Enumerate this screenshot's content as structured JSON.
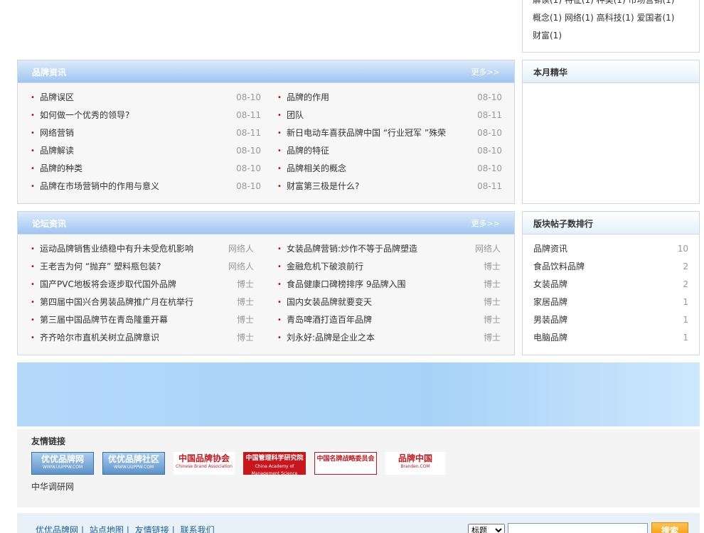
{
  "tags": {
    "line1": "解读(1) 特征(1) 种类(1) 市场营销(1)",
    "line2": "概念(1)  网络(1)  高科技(1)  爱国者(1)",
    "line3": "财富(1)"
  },
  "brand_news": {
    "title": "品牌资讯",
    "more": "更多>>",
    "left": [
      {
        "title": "品牌误区",
        "date": "08-10"
      },
      {
        "title": "如何做一个优秀的领导?",
        "date": "08-11"
      },
      {
        "title": "网络营销",
        "date": "08-11"
      },
      {
        "title": "品牌解读",
        "date": "08-10"
      },
      {
        "title": "品牌的种类",
        "date": "08-10"
      },
      {
        "title": "品牌在市场营销中的作用与意义",
        "date": "08-10"
      }
    ],
    "right": [
      {
        "title": "品牌的作用",
        "date": "08-10"
      },
      {
        "title": "团队",
        "date": "08-11"
      },
      {
        "title": "新日电动车喜获品牌中国 “行业冠军 ”殊荣",
        "date": "08-10"
      },
      {
        "title": "品牌的特征",
        "date": "08-10"
      },
      {
        "title": "品牌相关的概念",
        "date": "08-10"
      },
      {
        "title": "财富第三极是什么?",
        "date": "08-11"
      }
    ]
  },
  "monthly": {
    "title": "本月精华"
  },
  "forum_news": {
    "title": "论坛资讯",
    "more": "更多>>",
    "left": [
      {
        "title": "运动品牌销售业绩稳中有升未受危机影响",
        "author": "网络人"
      },
      {
        "title": "王老吉为何 “抛弃” 塑料瓶包装?",
        "author": "网络人"
      },
      {
        "title": "国产PVC地板将会逐步取代国外品牌",
        "author": "博士"
      },
      {
        "title": "第四届中国兴合男装品牌推广月在杭举行",
        "author": "博士"
      },
      {
        "title": "第三届中国品牌节在青岛隆重开幕",
        "author": "博士"
      },
      {
        "title": "齐齐哈尔市直机关树立品牌意识",
        "author": "博士"
      }
    ],
    "right": [
      {
        "title": "女装品牌营销:炒作不等于品牌塑造",
        "author": "网络人"
      },
      {
        "title": "金融危机下破浪前行",
        "author": "博士"
      },
      {
        "title": "食品健康口碑榜排序 9品牌入围",
        "author": "博士"
      },
      {
        "title": "国内女装品牌就要变天",
        "author": "博士"
      },
      {
        "title": "青岛啤酒打造百年品牌",
        "author": "博士"
      },
      {
        "title": "刘永好:品牌是企业之本",
        "author": "博士"
      }
    ]
  },
  "ranking": {
    "title": "版块帖子数排行",
    "items": [
      {
        "name": "品牌资讯",
        "count": "10"
      },
      {
        "name": "食品饮料品牌",
        "count": "2"
      },
      {
        "name": "女装品牌",
        "count": "2"
      },
      {
        "name": "家居品牌",
        "count": "1"
      },
      {
        "name": "男装品牌",
        "count": "1"
      },
      {
        "name": "电脑品牌",
        "count": "1"
      }
    ]
  },
  "friends": {
    "title": "友情链接",
    "logos": [
      {
        "text": "优优品牌网",
        "sub": "WWW.UUPPW.COM"
      },
      {
        "text": "优优品牌社区",
        "sub": "WWW.UUPPW.COM"
      },
      {
        "text": "中国品牌协会",
        "sub": "Chinese Brand Association"
      },
      {
        "text": "中国管理科学研究院",
        "sub": "China Academy of Management Science"
      },
      {
        "text": "中国名牌战略委员会",
        "sub": ""
      },
      {
        "text": "品牌中国",
        "sub": "Branden.COM"
      }
    ],
    "text_link": "中华调研网"
  },
  "footer": {
    "links": [
      "优优品牌网",
      "站点地图",
      "友情链接",
      "联系我们"
    ],
    "select_value": "标题",
    "search_button": "搜索"
  }
}
